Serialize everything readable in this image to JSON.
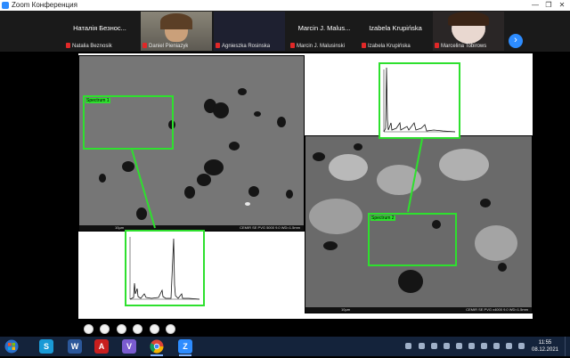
{
  "window": {
    "title": "Zoom Конференция",
    "controls": [
      "—",
      "❐",
      "✕"
    ]
  },
  "gallery": {
    "participants": [
      {
        "name": "Наталія Безнос...",
        "label": "Natalia Beznosik",
        "muted": true,
        "video": false
      },
      {
        "name": "",
        "label": "Daniel Pieniazyk",
        "muted": true,
        "video": true,
        "active": true
      },
      {
        "name": "",
        "label": "Agnieszka Rosinska",
        "muted": true,
        "video": true
      },
      {
        "name": "Marcin J. Malus...",
        "label": "Marcin J. Malusinski",
        "muted": true,
        "video": false
      },
      {
        "name": "Izabela Krupińska",
        "label": "Izabela Krupińska",
        "muted": true,
        "video": false
      },
      {
        "name": "",
        "label": "Marcelina Tobirows",
        "muted": true,
        "video": true
      }
    ],
    "next_icon": "chevron-right-icon"
  },
  "slide": {
    "spectrum_1_label": "Spectrum 1",
    "spectrum_2_label": "Spectrum 2",
    "sem1_scale": "10µm",
    "sem1_info": "CEMIR  SE  PVG  5000  9.0  WD=1.5mm",
    "sem2_scale": "10µm",
    "sem2_info": "CEMIR  SE  PVG  x4000  9.0  WD=1.5mm",
    "colors": {
      "highlight": "#2ee02e",
      "sem_gray": "#6c6c6c"
    }
  },
  "taskbar": {
    "apps": [
      {
        "name": "skype-icon",
        "glyph": "S",
        "color": "#1a9ad6"
      },
      {
        "name": "word-icon",
        "glyph": "W",
        "color": "#2b579a"
      },
      {
        "name": "acrobat-icon",
        "glyph": "A",
        "color": "#c81e1e"
      },
      {
        "name": "viber-icon",
        "glyph": "V",
        "color": "#7a5cd0"
      },
      {
        "name": "chrome-icon",
        "glyph": "",
        "color": "#e8e8e8"
      },
      {
        "name": "zoom-icon",
        "glyph": "Z",
        "color": "#2d8cff"
      }
    ],
    "time": "11:55",
    "date": "08.12.2021"
  }
}
